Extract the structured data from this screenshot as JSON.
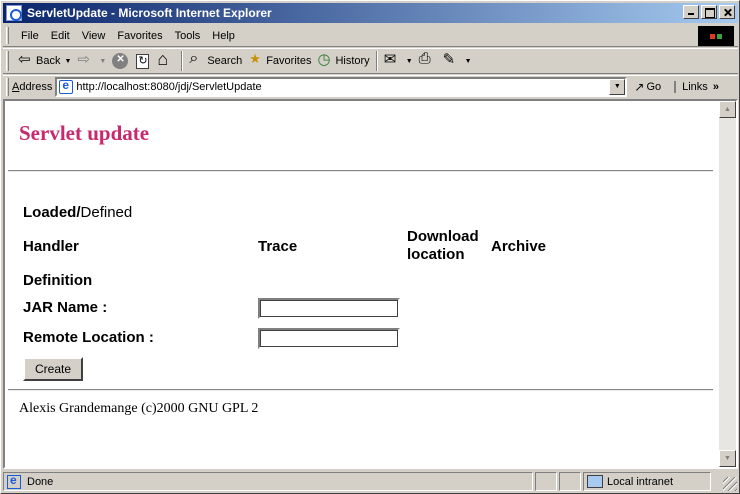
{
  "window": {
    "title": "ServletUpdate - Microsoft Internet Explorer"
  },
  "menu": {
    "items": [
      {
        "first": "F",
        "rest": "ile"
      },
      {
        "first": "E",
        "rest": "dit"
      },
      {
        "first": "V",
        "rest": "iew"
      },
      {
        "first": "",
        "pre": "F",
        "rest": "avorites",
        "underline": "a"
      },
      {
        "first": "T",
        "rest": "ools"
      },
      {
        "first": "H",
        "rest": "elp"
      }
    ],
    "labels": [
      "File",
      "Edit",
      "View",
      "Favorites",
      "Tools",
      "Help"
    ]
  },
  "toolbar": {
    "back_label": "Back",
    "search_label": "Search",
    "favorites_label": "Favorites",
    "history_label": "History"
  },
  "address": {
    "label_underlined": "A",
    "label_rest": "ddress",
    "url": "http://localhost:8080/jdj/ServletUpdate",
    "go_label": "Go",
    "links_label": "Links"
  },
  "page": {
    "heading": "Servlet update",
    "loaded_bold": "Loaded/",
    "loaded_rest": "Defined",
    "columns": {
      "handler": "Handler",
      "trace": "Trace",
      "download": "Download location",
      "archive": "Archive"
    },
    "definition_label": "Definition",
    "jar_label": "JAR Name :",
    "remote_label": "Remote Location :",
    "jar_value": "",
    "remote_value": "",
    "create_label": "Create",
    "footer": "Alexis Grandemange (c)2000 GNU GPL 2"
  },
  "status": {
    "text": "Done",
    "zone": "Local intranet"
  }
}
